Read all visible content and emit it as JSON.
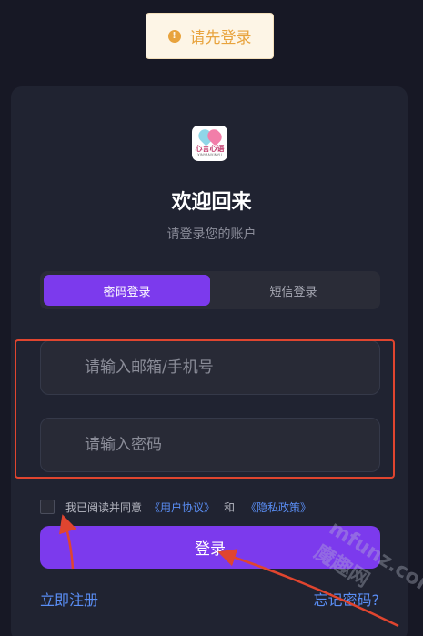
{
  "toast": {
    "icon": "warning-icon",
    "text": "请先登录"
  },
  "logo": {
    "text": "心言心语",
    "sub": "XINYANXINYU"
  },
  "header": {
    "title": "欢迎回来",
    "subtitle": "请登录您的账户"
  },
  "tabs": [
    {
      "label": "密码登录",
      "active": true
    },
    {
      "label": "短信登录",
      "active": false
    }
  ],
  "form": {
    "account_placeholder": "请输入邮箱/手机号",
    "password_placeholder": "请输入密码"
  },
  "agreement": {
    "prefix": "我已阅读并同意",
    "user_agreement": "《用户协议》",
    "and": "和",
    "privacy_policy": "《隐私政策》"
  },
  "login_button": "登录",
  "links": {
    "register": "立即注册",
    "forgot": "忘记密码?"
  },
  "watermark": "mfunz.com 魔趣网",
  "colors": {
    "background": "#171825",
    "card": "#202331",
    "accent": "#7c3aed",
    "link": "#5a8ef5",
    "annotation": "#e0452f"
  }
}
